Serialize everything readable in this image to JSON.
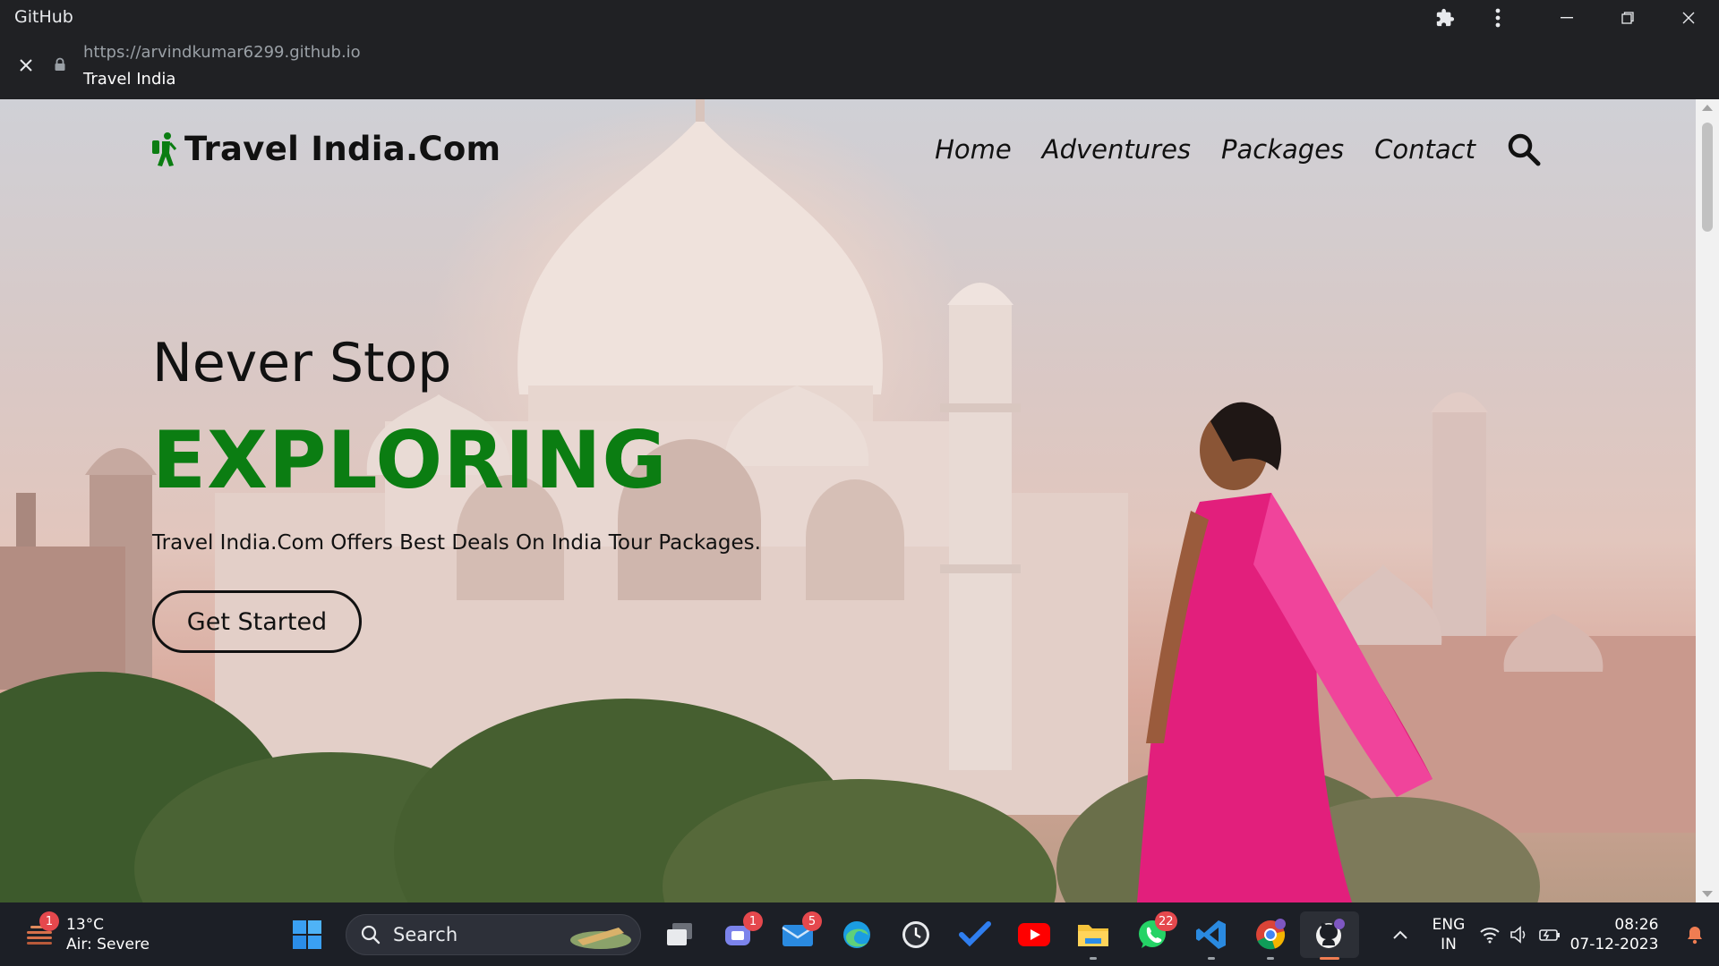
{
  "chrome": {
    "app_title": "GitHub",
    "url": "https://arvindkumar6299.github.io",
    "page_title": "Travel India"
  },
  "site": {
    "logo_text": "Travel India.Com",
    "nav": [
      "Home",
      "Adventures",
      "Packages",
      "Contact"
    ],
    "hero": {
      "line1": "Never Stop",
      "line2": "EXPLORING",
      "tagline": "Travel India.Com Offers Best Deals On India Tour Packages.",
      "cta": "Get Started"
    },
    "accent_color": "#0b7d12"
  },
  "taskbar": {
    "weather_temp": "13°C",
    "weather_desc": "Air: Severe",
    "weather_badge": "1",
    "search_label": "Search",
    "teams_badge": "1",
    "mail_badge": "5",
    "whatsapp_badge": "22",
    "lang_line1": "ENG",
    "lang_line2": "IN",
    "time": "08:26",
    "date": "07-12-2023"
  }
}
